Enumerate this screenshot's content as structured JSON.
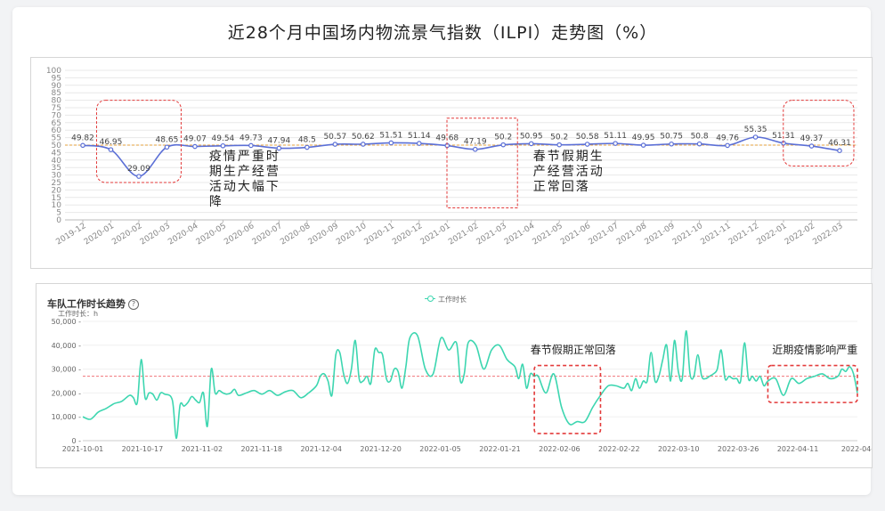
{
  "page": {
    "title": "近28个月中国场内物流景气指数（ILPI）走势图（%）"
  },
  "colors": {
    "line1": "#5b6fd6",
    "ref1": "#e6a23c",
    "line2": "#3dd6b0",
    "ref2": "#f0767a",
    "box": "#e33b3b",
    "grid": "#e8e8e8",
    "axis_text": "#888888"
  },
  "chart_data": [
    {
      "type": "line",
      "title": "近28个月中国场内物流景气指数（ILPI）走势图（%）",
      "categories": [
        "2019-12",
        "2020-01",
        "2020-02",
        "2020-03",
        "2020-04",
        "2020-05",
        "2020-06",
        "2020-07",
        "2020-08",
        "2020-09",
        "2020-10",
        "2020-11",
        "2020-12",
        "2021-01",
        "2021-02",
        "2021-03",
        "2021-04",
        "2021-05",
        "2021-06",
        "2021-07",
        "2021-08",
        "2021-09",
        "2021-10",
        "2021-11",
        "2021-12",
        "2022-01",
        "2022-02",
        "2022-03"
      ],
      "values": [
        49.82,
        46.95,
        29.09,
        48.65,
        49.07,
        49.54,
        49.73,
        47.94,
        48.5,
        50.57,
        50.62,
        51.51,
        51.14,
        49.68,
        47.19,
        50.2,
        50.95,
        50.2,
        50.58,
        51.11,
        49.95,
        50.75,
        50.8,
        49.76,
        55.35,
        51.31,
        49.37,
        46.31
      ],
      "value_labels": [
        "49.82",
        "46.95",
        "29.09",
        "48.65",
        "49.07",
        "49.54",
        "49.73",
        "47.94",
        "48.5",
        "50.57",
        "50.62",
        "51.51",
        "51.14",
        "49.68",
        "47.19",
        "50.2",
        "50.95",
        "50.2",
        "50.58",
        "51.11",
        "49.95",
        "50.75",
        "50.8",
        "49.76",
        "55.35",
        "51.31",
        "49.37",
        "46.31"
      ],
      "y_ticks": [
        0,
        5,
        10,
        15,
        20,
        25,
        30,
        35,
        40,
        45,
        50,
        55,
        60,
        65,
        70,
        75,
        80,
        85,
        90,
        95,
        100
      ],
      "ylim": [
        0,
        100
      ],
      "reference_line": 50,
      "grid": true,
      "annotations": [
        {
          "text": "疫情严重时\n期生产经营\n活动大幅下\n降"
        },
        {
          "text": "春节假期生\n产经营活动\n正常回落"
        }
      ]
    },
    {
      "type": "line",
      "title": "车队工作时长趋势",
      "ylabel": "工作时长：h",
      "legend": "工作时长",
      "legend_position": "top-center",
      "x_ticks": [
        "2021-10-01",
        "2021-10-17",
        "2021-11-02",
        "2021-11-18",
        "2021-12-04",
        "2021-12-20",
        "2022-01-05",
        "2022-01-21",
        "2022-02-06",
        "2022-02-22",
        "2022-03-10",
        "2022-03-26",
        "2022-04-11",
        "2022-04-"
      ],
      "y_ticks": [
        0,
        10000,
        20000,
        30000,
        40000,
        50000
      ],
      "y_tick_labels": [
        "0 -",
        "10,000 -",
        "20,000 -",
        "30,000 -",
        "40,000 -",
        "50,000 -"
      ],
      "ylim": [
        0,
        50000
      ],
      "reference_line": 27000,
      "annotations": [
        {
          "text": "春节假期正常回落"
        },
        {
          "text": "近期疫情影响严重"
        }
      ],
      "x_start": "2021-10-01",
      "x_end": "2022-04-18",
      "x": [
        "2021-10-01",
        "2021-10-03",
        "2021-10-05",
        "2021-10-07",
        "2021-10-09",
        "2021-10-11",
        "2021-10-13",
        "2021-10-14",
        "2021-10-15",
        "2021-10-16",
        "2021-10-17",
        "2021-10-18",
        "2021-10-19",
        "2021-10-20",
        "2021-10-21",
        "2021-10-22",
        "2021-10-24",
        "2021-10-25",
        "2021-10-26",
        "2021-10-27",
        "2021-10-28",
        "2021-10-29",
        "2021-10-30",
        "2021-10-31",
        "2021-11-01",
        "2021-11-02",
        "2021-11-03",
        "2021-11-04",
        "2021-11-05",
        "2021-11-06",
        "2021-11-07",
        "2021-11-08",
        "2021-11-09",
        "2021-11-10",
        "2021-11-12",
        "2021-11-14",
        "2021-11-16",
        "2021-11-18",
        "2021-11-20",
        "2021-11-22",
        "2021-11-24",
        "2021-11-26",
        "2021-11-28",
        "2021-11-30",
        "2021-12-01",
        "2021-12-02",
        "2021-12-03",
        "2021-12-04",
        "2021-12-05",
        "2021-12-06",
        "2021-12-07",
        "2021-12-08",
        "2021-12-09",
        "2021-12-10",
        "2021-12-11",
        "2021-12-12",
        "2021-12-13",
        "2021-12-14",
        "2021-12-15",
        "2021-12-16",
        "2021-12-17",
        "2021-12-18",
        "2021-12-19",
        "2021-12-20",
        "2021-12-21",
        "2021-12-22",
        "2021-12-23",
        "2021-12-24",
        "2021-12-26",
        "2021-12-28",
        "2021-12-30",
        "2022-01-01",
        "2022-01-03",
        "2022-01-05",
        "2022-01-06",
        "2022-01-07",
        "2022-01-08",
        "2022-01-10",
        "2022-01-12",
        "2022-01-14",
        "2022-01-16",
        "2022-01-18",
        "2022-01-20",
        "2022-01-21",
        "2022-01-22",
        "2022-01-23",
        "2022-01-24",
        "2022-01-25",
        "2022-01-26",
        "2022-01-28",
        "2022-01-30",
        "2022-02-01",
        "2022-02-03",
        "2022-02-05",
        "2022-02-07",
        "2022-02-09",
        "2022-02-11",
        "2022-02-13",
        "2022-02-15",
        "2022-02-17",
        "2022-02-18",
        "2022-02-19",
        "2022-02-20",
        "2022-02-21",
        "2022-02-22",
        "2022-02-23",
        "2022-02-24",
        "2022-02-25",
        "2022-02-26",
        "2022-02-27",
        "2022-02-28",
        "2022-03-01",
        "2022-03-02",
        "2022-03-03",
        "2022-03-04",
        "2022-03-05",
        "2022-03-06",
        "2022-03-07",
        "2022-03-08",
        "2022-03-09",
        "2022-03-10",
        "2022-03-11",
        "2022-03-12",
        "2022-03-13",
        "2022-03-14",
        "2022-03-15",
        "2022-03-16",
        "2022-03-17",
        "2022-03-18",
        "2022-03-19",
        "2022-03-20",
        "2022-03-21",
        "2022-03-22",
        "2022-03-23",
        "2022-03-24",
        "2022-03-25",
        "2022-03-26",
        "2022-03-28",
        "2022-03-30",
        "2022-04-01",
        "2022-04-03",
        "2022-04-05",
        "2022-04-07",
        "2022-04-09",
        "2022-04-11",
        "2022-04-13",
        "2022-04-14",
        "2022-04-15",
        "2022-04-16",
        "2022-04-17",
        "2022-04-18"
      ],
      "values": [
        10000,
        9000,
        12000,
        13500,
        15500,
        16500,
        19000,
        18000,
        16000,
        34000,
        18000,
        20000,
        19500,
        17000,
        20000,
        19500,
        17000,
        1000,
        15000,
        14500,
        16000,
        18500,
        17000,
        16000,
        20000,
        6000,
        30000,
        20000,
        21000,
        20000,
        19500,
        20000,
        21500,
        19000,
        20000,
        21000,
        19500,
        21000,
        19000,
        20500,
        21000,
        18000,
        20000,
        23000,
        27000,
        28000,
        25000,
        19000,
        36000,
        37000,
        28000,
        24000,
        30000,
        42000,
        26000,
        25000,
        27000,
        24000,
        38000,
        37000,
        36000,
        26000,
        25000,
        30000,
        29000,
        22000,
        31000,
        43000,
        44000,
        30000,
        28000,
        43000,
        38000,
        41000,
        25000,
        28000,
        41000,
        40000,
        30000,
        38000,
        40000,
        34000,
        31000,
        26000,
        32000,
        22000,
        28000,
        27000,
        27000,
        20000,
        28000,
        14000,
        7000,
        8000,
        8000,
        14000,
        19000,
        23000,
        23000,
        22000,
        24000,
        21000,
        26000,
        22000,
        25000,
        25000,
        37000,
        25000,
        27000,
        34000,
        40000,
        25000,
        42000,
        29000,
        26000,
        46000,
        28000,
        27000,
        36000,
        27000,
        26000,
        27000,
        28000,
        30000,
        38000,
        26000,
        27000,
        26000,
        26000,
        25000,
        41000,
        26000,
        27000,
        25000,
        27000,
        23000,
        25000,
        26000,
        19000,
        26000,
        24000,
        26000,
        27000,
        28000,
        26000,
        27000,
        30000,
        29000,
        31000,
        28000,
        20000
      ]
    }
  ]
}
